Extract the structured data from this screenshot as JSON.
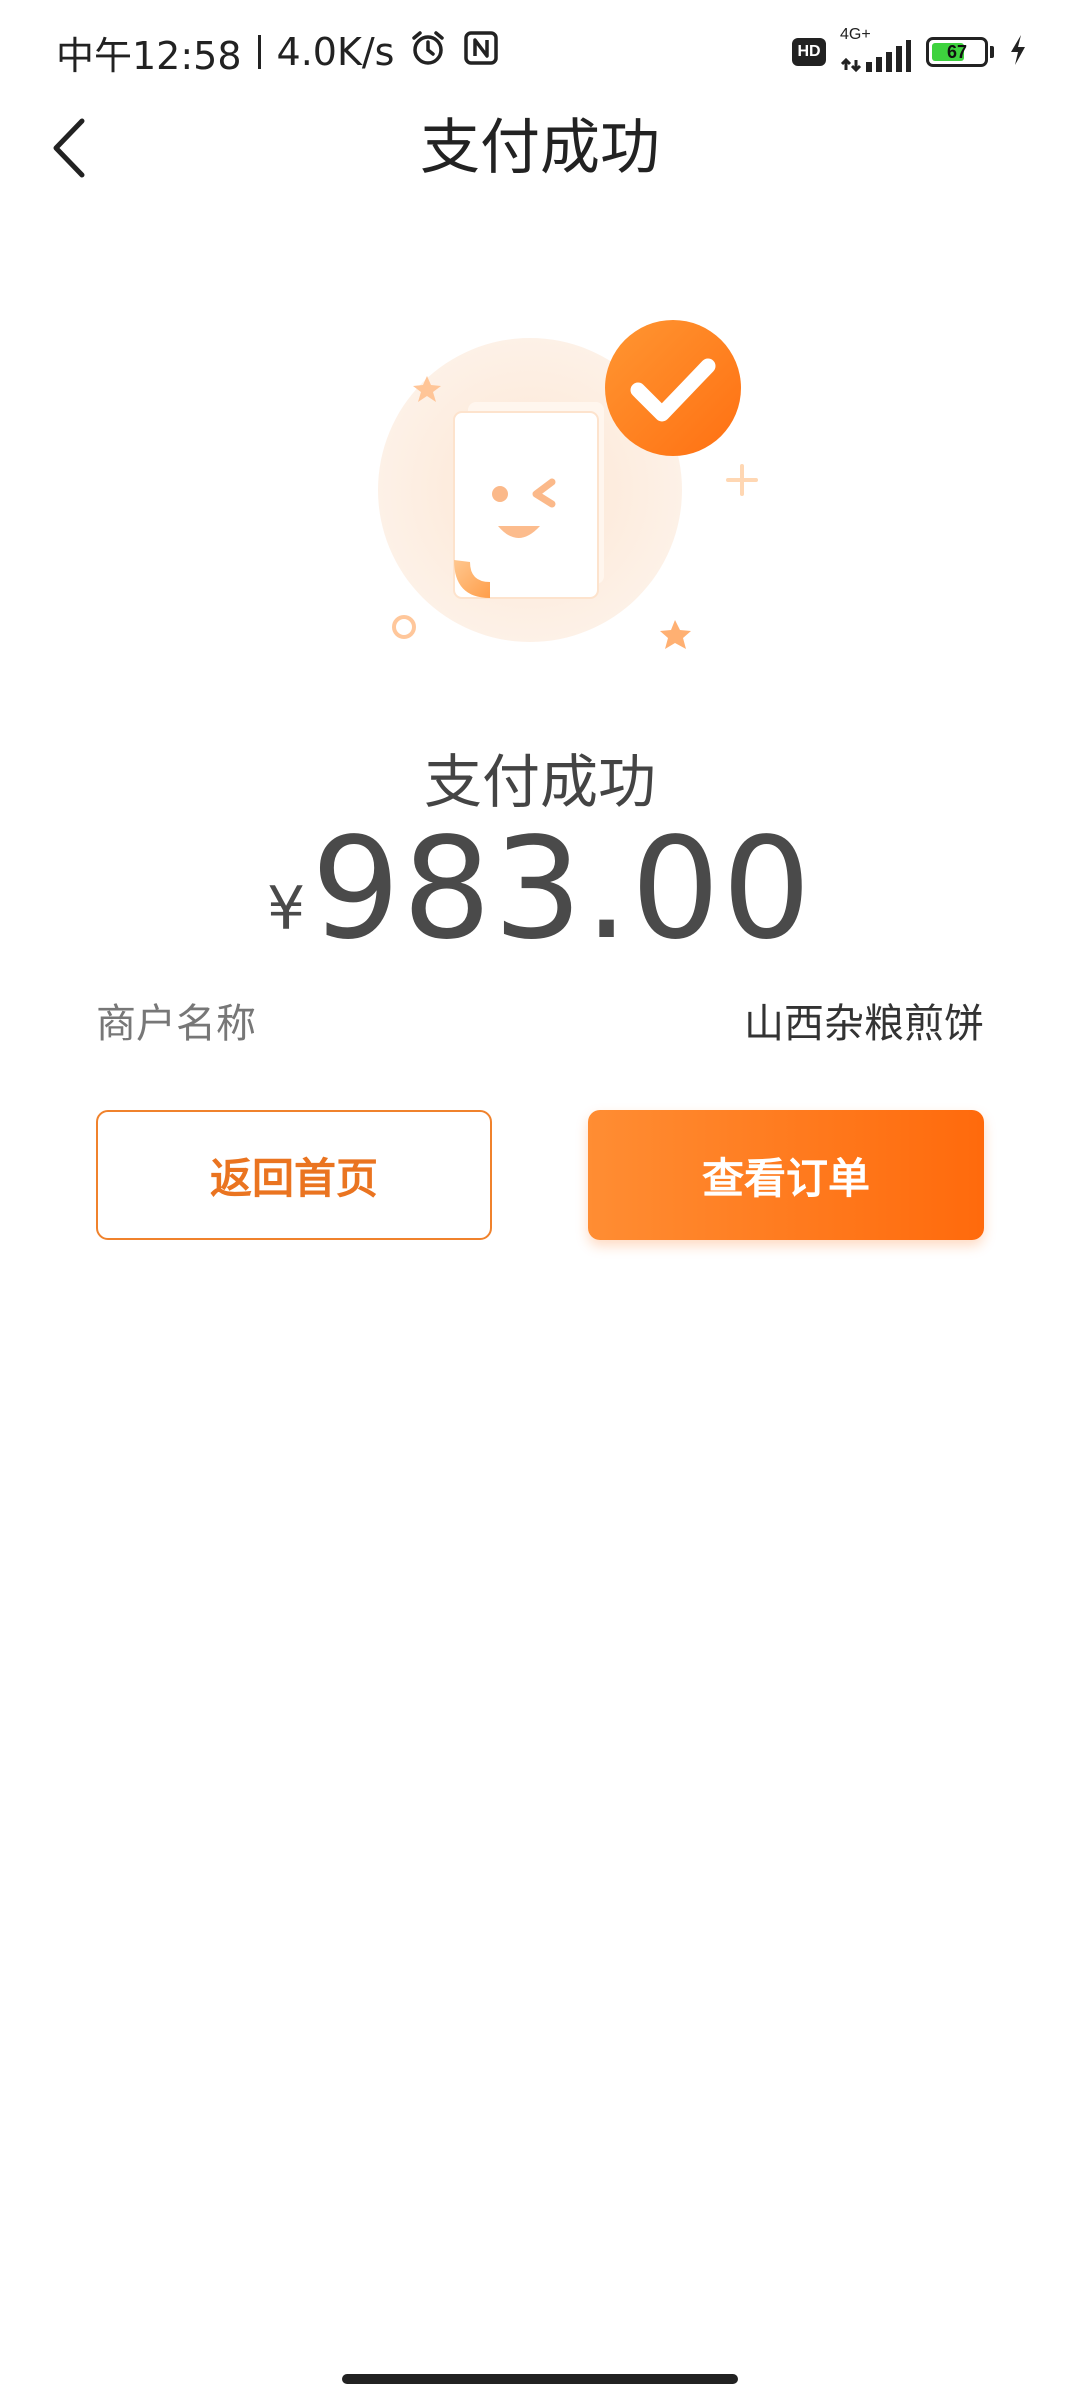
{
  "status_bar": {
    "time": "中午12:58",
    "speed": "4.0K/s",
    "hd": "HD",
    "network": "4G+",
    "battery": "67",
    "battery_level": 0.67,
    "icons": [
      "alarm-icon",
      "nfc-icon",
      "signal-icon",
      "charging-icon"
    ]
  },
  "nav": {
    "title": "支付成功",
    "back_icon": "chevron-left-icon"
  },
  "result": {
    "title": "支付成功",
    "currency_symbol": "¥",
    "amount": "983.00"
  },
  "merchant": {
    "label": "商户名称",
    "value": "山西杂粮煎饼"
  },
  "buttons": {
    "home_label": "返回首页",
    "order_label": "查看订单"
  },
  "colors": {
    "accent": "#ff7a1a",
    "accent_light": "#fde7d6",
    "text_dark": "#333333",
    "text_muted": "#777777"
  }
}
